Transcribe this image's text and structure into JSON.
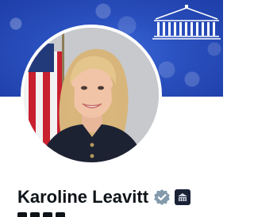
{
  "profile": {
    "display_name": "Karoline Leavitt",
    "verified_badge": "verified-check-icon",
    "affiliation_badge": "white-house-affiliate-icon"
  },
  "banner": {
    "logo": "white-house-icon",
    "color": "#2a50bf"
  },
  "colors": {
    "text_primary": "#0f1419",
    "verified_gray": "#829aab",
    "avatar_ring": "#ffffff"
  }
}
